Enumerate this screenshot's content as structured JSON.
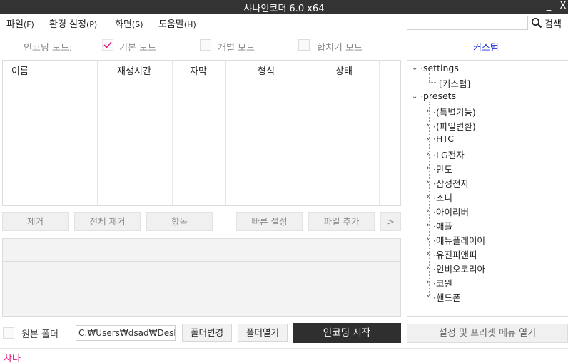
{
  "window": {
    "title": "샤나인코더 6.0 x64",
    "minimize_label": "_",
    "close_label": "X"
  },
  "menu": [
    {
      "label": "파일",
      "accel": "(F)"
    },
    {
      "label": "환경 설정",
      "accel": "(P)"
    },
    {
      "label": "화면",
      "accel": "(S)"
    },
    {
      "label": "도움말",
      "accel": "(H)"
    }
  ],
  "search": {
    "value": "",
    "label": "검색"
  },
  "mode": {
    "label": "인코딩 모드:",
    "options": [
      {
        "label": "기본 모드",
        "checked": true
      },
      {
        "label": "개별 모드",
        "checked": false
      },
      {
        "label": "합치기 모드",
        "checked": false
      }
    ],
    "custom_label": "커스텀",
    "custom_color": "#1c31d6"
  },
  "table": {
    "columns": [
      "이름",
      "재생시간",
      "자막",
      "형식",
      "상태"
    ],
    "rows": []
  },
  "actions": {
    "remove": "제거",
    "remove_all": "전체 제거",
    "items": "항목",
    "quick_settings": "빠른 설정",
    "add_file": "파일 추가",
    "more": ">"
  },
  "tree": {
    "settings_label": "settings",
    "custom_child": "[커스텀]",
    "presets_label": "presets",
    "presets": [
      "(특별기능)",
      "(파일변환)",
      "HTC",
      "LG전자",
      "만도",
      "삼성전자",
      "소니",
      "아이리버",
      "애플",
      "에듀플레이어",
      "유진피앤피",
      "인비오코리아",
      "코원",
      "핸드폰"
    ]
  },
  "bottom": {
    "original_folder_label": "원본 폴더",
    "original_folder_checked": false,
    "folder_path": "C:₩Users₩dsad₩Desktop",
    "change_folder": "폴더변경",
    "open_folder": "폴더열기",
    "start_encoding": "인코딩 시작",
    "settings_menu": "설정 및 프리셋 메뉴 열기"
  },
  "status": {
    "text": "샤나",
    "color": "#e0157f"
  }
}
